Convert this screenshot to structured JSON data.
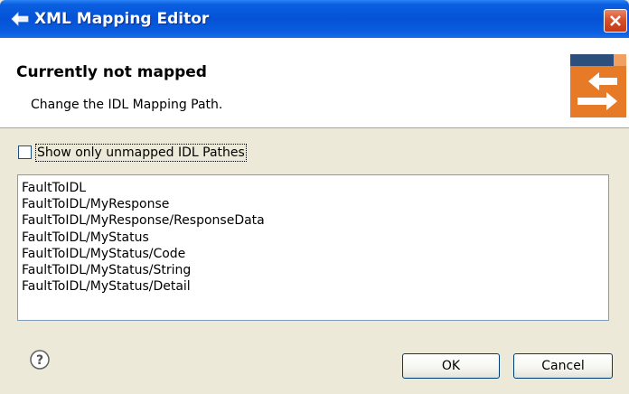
{
  "window": {
    "title": "XML Mapping Editor",
    "close_icon": "close-icon",
    "accent_color": "#0552d6"
  },
  "header": {
    "title": "Currently not mapped",
    "description": "Change the IDL Mapping Path.",
    "icon": "mapping-wizard-icon"
  },
  "filter": {
    "label": "Show only unmapped IDL Pathes",
    "checked": false
  },
  "paths": [
    "FaultToIDL",
    "FaultToIDL/MyResponse",
    "FaultToIDL/MyResponse/ResponseData",
    "FaultToIDL/MyStatus",
    "FaultToIDL/MyStatus/Code",
    "FaultToIDL/MyStatus/String",
    "FaultToIDL/MyStatus/Detail"
  ],
  "footer": {
    "help_icon": "help-icon",
    "ok_label": "OK",
    "cancel_label": "Cancel"
  }
}
